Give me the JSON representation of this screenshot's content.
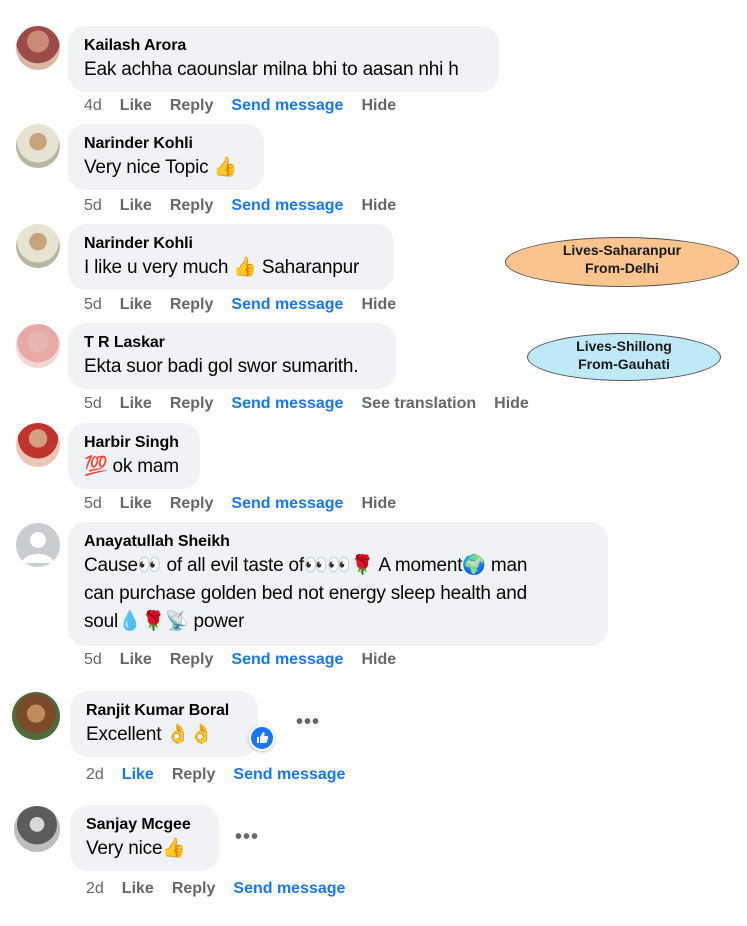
{
  "comments": [
    {
      "author": "Kailash Arora",
      "text": "Eak achha caounslar milna bhi to aasan nhi h",
      "time": "4d",
      "like": "Like",
      "reply": "Reply",
      "send": "Send message",
      "hide": "Hide"
    },
    {
      "author": "Narinder Kohli",
      "text": "Very nice Topic 👍",
      "time": "5d",
      "like": "Like",
      "reply": "Reply",
      "send": "Send message",
      "hide": "Hide"
    },
    {
      "author": "Narinder Kohli",
      "text": "I like u very much 👍 Saharanpur",
      "time": "5d",
      "like": "Like",
      "reply": "Reply",
      "send": "Send message",
      "hide": "Hide"
    },
    {
      "author": "T R Laskar",
      "text": "Ekta suor badi gol swor sumarith.",
      "time": "5d",
      "like": "Like",
      "reply": "Reply",
      "send": "Send message",
      "see_translation": "See translation",
      "hide": "Hide"
    },
    {
      "author": "Harbir Singh",
      "text": "💯 ok mam",
      "time": "5d",
      "like": "Like",
      "reply": "Reply",
      "send": "Send message",
      "hide": "Hide"
    },
    {
      "author": "Anayatullah Sheikh",
      "text_lines": [
        "Cause👀 of all evil taste of👀👀🌹 A moment🌍 man",
        "can purchase golden bed not energy sleep health and",
        "soul💧🌹📡 power"
      ],
      "time": "5d",
      "like": "Like",
      "reply": "Reply",
      "send": "Send message",
      "hide": "Hide"
    },
    {
      "author": "Ranjit Kumar Boral",
      "text": "Excellent 👌👌",
      "time": "2d",
      "like": "Like",
      "reply": "Reply",
      "send": "Send message",
      "more": "•••"
    },
    {
      "author": "Sanjay Mcgee",
      "text": "Very nice👍",
      "time": "2d",
      "like": "Like",
      "reply": "Reply",
      "send": "Send message",
      "more": "•••"
    }
  ],
  "annotations": [
    {
      "line1": "Lives-Saharanpur",
      "line2": "From-Delhi",
      "color": "#fbc48e"
    },
    {
      "line1": "Lives-Shillong",
      "line2": "From-Gauhati",
      "color": "#bfe9f7"
    }
  ],
  "colors": {
    "bubble": "#f0f2f5",
    "link": "#1877f2",
    "muted": "#65676b"
  },
  "icons": {
    "like_reaction": "thumbs-up-icon",
    "more": "more-options-icon"
  }
}
